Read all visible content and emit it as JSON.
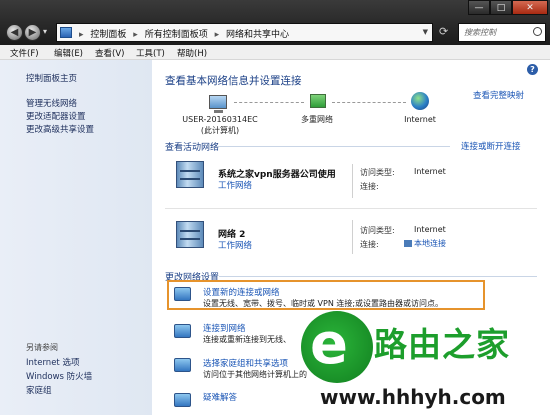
{
  "address_bar": {
    "breadcrumbs": [
      "控制面板",
      "所有控制面板项",
      "网络和共享中心"
    ],
    "separator": "▸",
    "search_placeholder": "搜索控制"
  },
  "window_controls": {
    "minimize": "—",
    "maximize": "□",
    "close": "✕"
  },
  "menu": [
    "文件(F)",
    "编辑(E)",
    "查看(V)",
    "工具(T)",
    "帮助(H)"
  ],
  "sidebar": {
    "home": "控制面板主页",
    "items": [
      "管理无线网络",
      "更改适配器设置",
      "更改高级共享设置"
    ],
    "see_also_header": "另请参阅",
    "see_also": [
      "Internet 选项",
      "Windows 防火墙",
      "家庭组"
    ]
  },
  "main": {
    "heading": "查看基本网络信息并设置连接",
    "full_map_link": "查看完整映射",
    "nodes": {
      "computer": "USER-20160314EC",
      "computer_sub": "(此计算机)",
      "network": "多重网络",
      "internet": "Internet"
    },
    "active_header": "查看活动网络",
    "connect_link": "连接或断开连接",
    "networks": [
      {
        "name": "系统之家vpn服务器公司使用",
        "type": "工作网络",
        "access_label": "访问类型:",
        "access_value": "Internet",
        "conn_label": "连接:",
        "conn_value": ""
      },
      {
        "name": "网络  2",
        "type": "工作网络",
        "access_label": "访问类型:",
        "access_value": "Internet",
        "conn_label": "连接:",
        "conn_value": "本地连接"
      }
    ],
    "change_header": "更改网络设置",
    "tasks": [
      {
        "title": "设置新的连接或网络",
        "desc": "设置无线、宽带、拨号、临时或 VPN 连接;或设置路由器或访问点。"
      },
      {
        "title": "连接到网络",
        "desc": "连接或重新连接到无线、"
      },
      {
        "title": "选择家庭组和共享选项",
        "desc": "访问位于其他网络计算机上的"
      },
      {
        "title": "疑难解答",
        "desc": ""
      }
    ]
  },
  "watermark": {
    "brand": "路由之家",
    "url": "www.hhhyh.com"
  }
}
